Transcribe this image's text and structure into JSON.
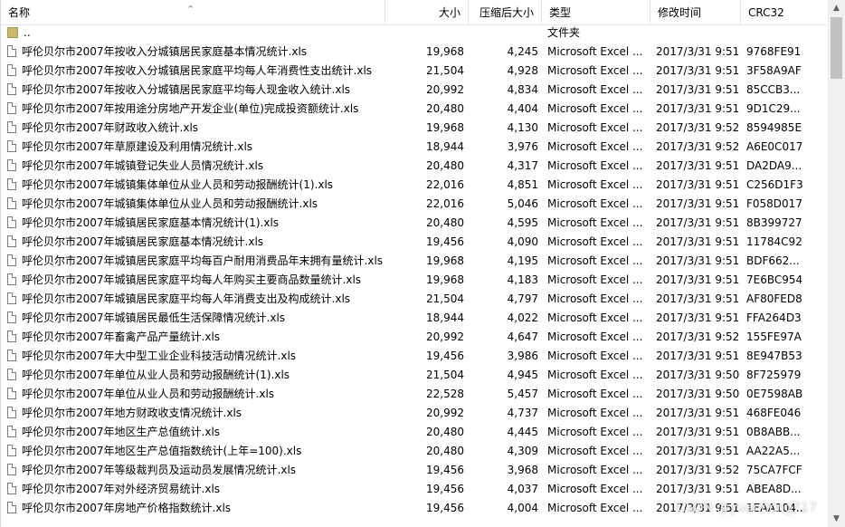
{
  "columns": {
    "name": "名称",
    "size": "大小",
    "packed": "压缩后大小",
    "type": "类型",
    "modified": "修改时间",
    "crc": "CRC32"
  },
  "sort_arrow": "⌃",
  "parent_row": {
    "name": "..",
    "type": "文件夹"
  },
  "files": [
    {
      "name": "呼伦贝尔市2007年按收入分城镇居民家庭基本情况统计.xls",
      "size": "19,968",
      "packed": "4,245",
      "type": "Microsoft Excel ...",
      "modified": "2017/3/31 9:51",
      "crc": "9768FE91"
    },
    {
      "name": "呼伦贝尔市2007年按收入分城镇居民家庭平均每人年消费性支出统计.xls",
      "size": "21,504",
      "packed": "4,928",
      "type": "Microsoft Excel ...",
      "modified": "2017/3/31 9:51",
      "crc": "3F58A9AF"
    },
    {
      "name": "呼伦贝尔市2007年按收入分城镇居民家庭平均每人现金收入统计.xls",
      "size": "20,992",
      "packed": "4,834",
      "type": "Microsoft Excel ...",
      "modified": "2017/3/31 9:51",
      "crc": "85CCB3..."
    },
    {
      "name": "呼伦贝尔市2007年按用途分房地产开发企业(单位)完成投资额统计.xls",
      "size": "20,480",
      "packed": "4,404",
      "type": "Microsoft Excel ...",
      "modified": "2017/3/31 9:51",
      "crc": "9D1C29..."
    },
    {
      "name": "呼伦贝尔市2007年财政收入统计.xls",
      "size": "19,968",
      "packed": "4,130",
      "type": "Microsoft Excel ...",
      "modified": "2017/3/31 9:52",
      "crc": "8594985E"
    },
    {
      "name": "呼伦贝尔市2007年草原建设及利用情况统计.xls",
      "size": "18,944",
      "packed": "3,976",
      "type": "Microsoft Excel ...",
      "modified": "2017/3/31 9:52",
      "crc": "A6E0C017"
    },
    {
      "name": "呼伦贝尔市2007年城镇登记失业人员情况统计.xls",
      "size": "20,480",
      "packed": "4,317",
      "type": "Microsoft Excel ...",
      "modified": "2017/3/31 9:51",
      "crc": "DA2DA9..."
    },
    {
      "name": "呼伦贝尔市2007年城镇集体单位从业人员和劳动报酬统计(1).xls",
      "size": "22,016",
      "packed": "4,851",
      "type": "Microsoft Excel ...",
      "modified": "2017/3/31 9:51",
      "crc": "C256D1F3"
    },
    {
      "name": "呼伦贝尔市2007年城镇集体单位从业人员和劳动报酬统计.xls",
      "size": "22,016",
      "packed": "5,046",
      "type": "Microsoft Excel ...",
      "modified": "2017/3/31 9:51",
      "crc": "F058D017"
    },
    {
      "name": "呼伦贝尔市2007年城镇居民家庭基本情况统计(1).xls",
      "size": "20,480",
      "packed": "4,595",
      "type": "Microsoft Excel ...",
      "modified": "2017/3/31 9:51",
      "crc": "8B399727"
    },
    {
      "name": "呼伦贝尔市2007年城镇居民家庭基本情况统计.xls",
      "size": "19,456",
      "packed": "4,090",
      "type": "Microsoft Excel ...",
      "modified": "2017/3/31 9:51",
      "crc": "11784C92"
    },
    {
      "name": "呼伦贝尔市2007年城镇居民家庭平均每百户耐用消费品年末拥有量统计.xls",
      "size": "19,968",
      "packed": "4,195",
      "type": "Microsoft Excel ...",
      "modified": "2017/3/31 9:51",
      "crc": "BDF662..."
    },
    {
      "name": "呼伦贝尔市2007年城镇居民家庭平均每人年购买主要商品数量统计.xls",
      "size": "19,968",
      "packed": "4,183",
      "type": "Microsoft Excel ...",
      "modified": "2017/3/31 9:51",
      "crc": "7E6BC954"
    },
    {
      "name": "呼伦贝尔市2007年城镇居民家庭平均每人年消费支出及构成统计.xls",
      "size": "21,504",
      "packed": "4,797",
      "type": "Microsoft Excel ...",
      "modified": "2017/3/31 9:51",
      "crc": "AF80FED8"
    },
    {
      "name": "呼伦贝尔市2007年城镇居民最低生活保障情况统计.xls",
      "size": "18,944",
      "packed": "4,022",
      "type": "Microsoft Excel ...",
      "modified": "2017/3/31 9:51",
      "crc": "FFA264D3"
    },
    {
      "name": "呼伦贝尔市2007年畜禽产品产量统计.xls",
      "size": "20,992",
      "packed": "4,647",
      "type": "Microsoft Excel ...",
      "modified": "2017/3/31 9:52",
      "crc": "155FE97A"
    },
    {
      "name": "呼伦贝尔市2007年大中型工业企业科技活动情况统计.xls",
      "size": "19,456",
      "packed": "3,986",
      "type": "Microsoft Excel ...",
      "modified": "2017/3/31 9:51",
      "crc": "8E947B53"
    },
    {
      "name": "呼伦贝尔市2007年单位从业人员和劳动报酬统计(1).xls",
      "size": "21,504",
      "packed": "4,945",
      "type": "Microsoft Excel ...",
      "modified": "2017/3/31 9:50",
      "crc": "8F725979"
    },
    {
      "name": "呼伦贝尔市2007年单位从业人员和劳动报酬统计.xls",
      "size": "22,528",
      "packed": "5,457",
      "type": "Microsoft Excel ...",
      "modified": "2017/3/31 9:50",
      "crc": "0E7598AB"
    },
    {
      "name": "呼伦贝尔市2007年地方财政收支情况统计.xls",
      "size": "20,992",
      "packed": "4,737",
      "type": "Microsoft Excel ...",
      "modified": "2017/3/31 9:51",
      "crc": "468FE046"
    },
    {
      "name": "呼伦贝尔市2007年地区生产总值统计.xls",
      "size": "20,480",
      "packed": "4,445",
      "type": "Microsoft Excel ...",
      "modified": "2017/3/31 9:51",
      "crc": "0B8ABB..."
    },
    {
      "name": "呼伦贝尔市2007年地区生产总值指数统计(上年=100).xls",
      "size": "20,480",
      "packed": "4,309",
      "type": "Microsoft Excel ...",
      "modified": "2017/3/31 9:51",
      "crc": "AA22A5..."
    },
    {
      "name": "呼伦贝尔市2007年等级裁判员及运动员发展情况统计.xls",
      "size": "19,456",
      "packed": "3,968",
      "type": "Microsoft Excel ...",
      "modified": "2017/3/31 9:52",
      "crc": "75CA7FCF"
    },
    {
      "name": "呼伦贝尔市2007年对外经济贸易统计.xls",
      "size": "19,456",
      "packed": "4,037",
      "type": "Microsoft Excel ...",
      "modified": "2017/3/31 9:51",
      "crc": "ABEA8D..."
    },
    {
      "name": "呼伦贝尔市2007年房地产价格指数统计.xls",
      "size": "19,456",
      "packed": "4,004",
      "type": "Microsoft Excel ...",
      "modified": "2017/3/31 9:51",
      "crc": "1EAA104..."
    }
  ],
  "watermark": "CSDN @yuanhong717"
}
